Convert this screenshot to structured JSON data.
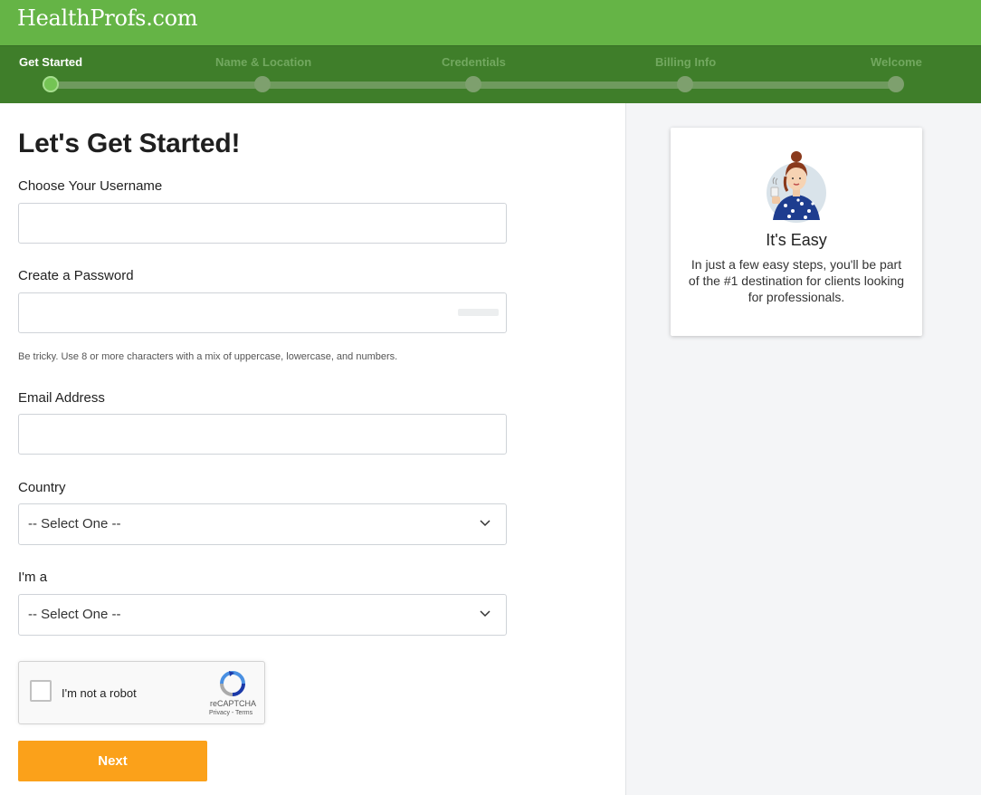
{
  "header": {
    "logo_text": "HealthProfs.com",
    "brand_color": "#65b446"
  },
  "steps": [
    {
      "label": "Get Started",
      "active": true
    },
    {
      "label": "Name & Location",
      "active": false
    },
    {
      "label": "Credentials",
      "active": false
    },
    {
      "label": "Billing Info",
      "active": false
    },
    {
      "label": "Welcome",
      "active": false
    }
  ],
  "form": {
    "title": "Let's Get Started!",
    "username_label": "Choose Your Username",
    "username_value": "",
    "password_label": "Create a Password",
    "password_value": "",
    "password_hint": "Be tricky. Use 8 or more characters with a mix of uppercase, lowercase, and numbers.",
    "email_label": "Email Address",
    "email_value": "",
    "country_label": "Country",
    "country_selected": "-- Select One --",
    "role_label": "I'm a",
    "role_selected": "-- Select One --",
    "captcha_text": "I'm not a robot",
    "captcha_brand": "reCAPTCHA",
    "captcha_terms": "Privacy - Terms",
    "next_label": "Next",
    "next_color": "#fba11a"
  },
  "side_card": {
    "title": "It's Easy",
    "text": "In just a few easy steps, you'll be part of the #1 destination for clients looking for professionals.",
    "illustration_icon": "woman-with-coffee-illustration"
  }
}
